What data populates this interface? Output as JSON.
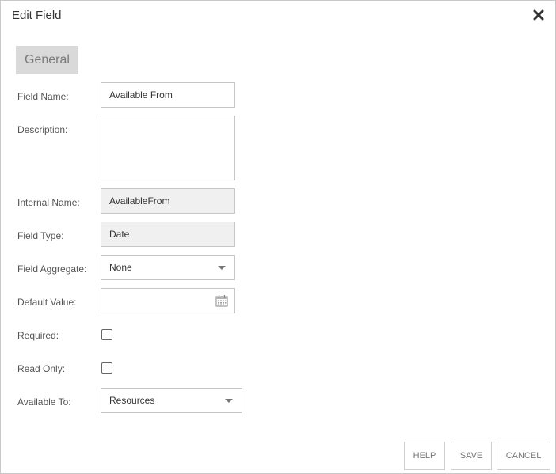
{
  "dialog": {
    "title": "Edit Field",
    "close_icon": "close-icon"
  },
  "tabs": [
    {
      "label": "General",
      "active": true
    }
  ],
  "form": {
    "field_name": {
      "label": "Field Name:",
      "value": "Available From"
    },
    "description": {
      "label": "Description:",
      "value": ""
    },
    "internal_name": {
      "label": "Internal Name:",
      "value": "AvailableFrom"
    },
    "field_type": {
      "label": "Field Type:",
      "value": "Date"
    },
    "field_aggregate": {
      "label": "Field Aggregate:",
      "value": "None"
    },
    "default_value": {
      "label": "Default Value:",
      "value": "",
      "icon": "calendar-icon"
    },
    "required": {
      "label": "Required:",
      "checked": false
    },
    "read_only": {
      "label": "Read Only:",
      "checked": false
    },
    "available_to": {
      "label": "Available To:",
      "value": "Resources"
    }
  },
  "buttons": {
    "help": "HELP",
    "save": "SAVE",
    "cancel": "CANCEL"
  },
  "colors": {
    "tab_bg": "#d9d9d9",
    "readonly_bg": "#f0f0f0",
    "border": "#c6c6c6"
  }
}
